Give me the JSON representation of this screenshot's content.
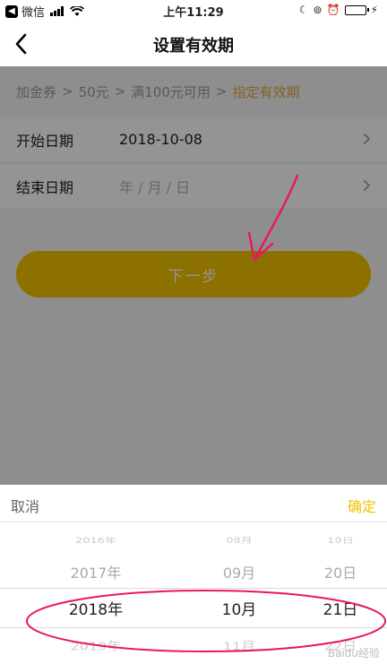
{
  "status_bar": {
    "back_app_label": "微信",
    "time": "上午11:29"
  },
  "nav": {
    "title": "设置有效期"
  },
  "breadcrumb": {
    "items": [
      "加金券",
      "50元",
      "满100元可用"
    ],
    "active": "指定有效期",
    "separator": ">"
  },
  "form": {
    "start_label": "开始日期",
    "start_value": "2018-10-08",
    "end_label": "结束日期",
    "end_placeholder": "年 / 月 / 日"
  },
  "next_button": {
    "label": "下一步"
  },
  "picker": {
    "cancel_label": "取消",
    "confirm_label": "确定",
    "years": [
      "2016年",
      "2017年",
      "2018年",
      "2019年"
    ],
    "months": [
      "08月",
      "09月",
      "10月",
      "11月"
    ],
    "days": [
      "19日",
      "20日",
      "21日",
      "22日"
    ],
    "selected": {
      "year": "2018年",
      "month": "10月",
      "day": "21日"
    }
  },
  "colors": {
    "accent": "#f2c200",
    "breadcrumb_active": "#e0a84d",
    "annotation": "#e8175d"
  },
  "watermark": "Baidu经验"
}
